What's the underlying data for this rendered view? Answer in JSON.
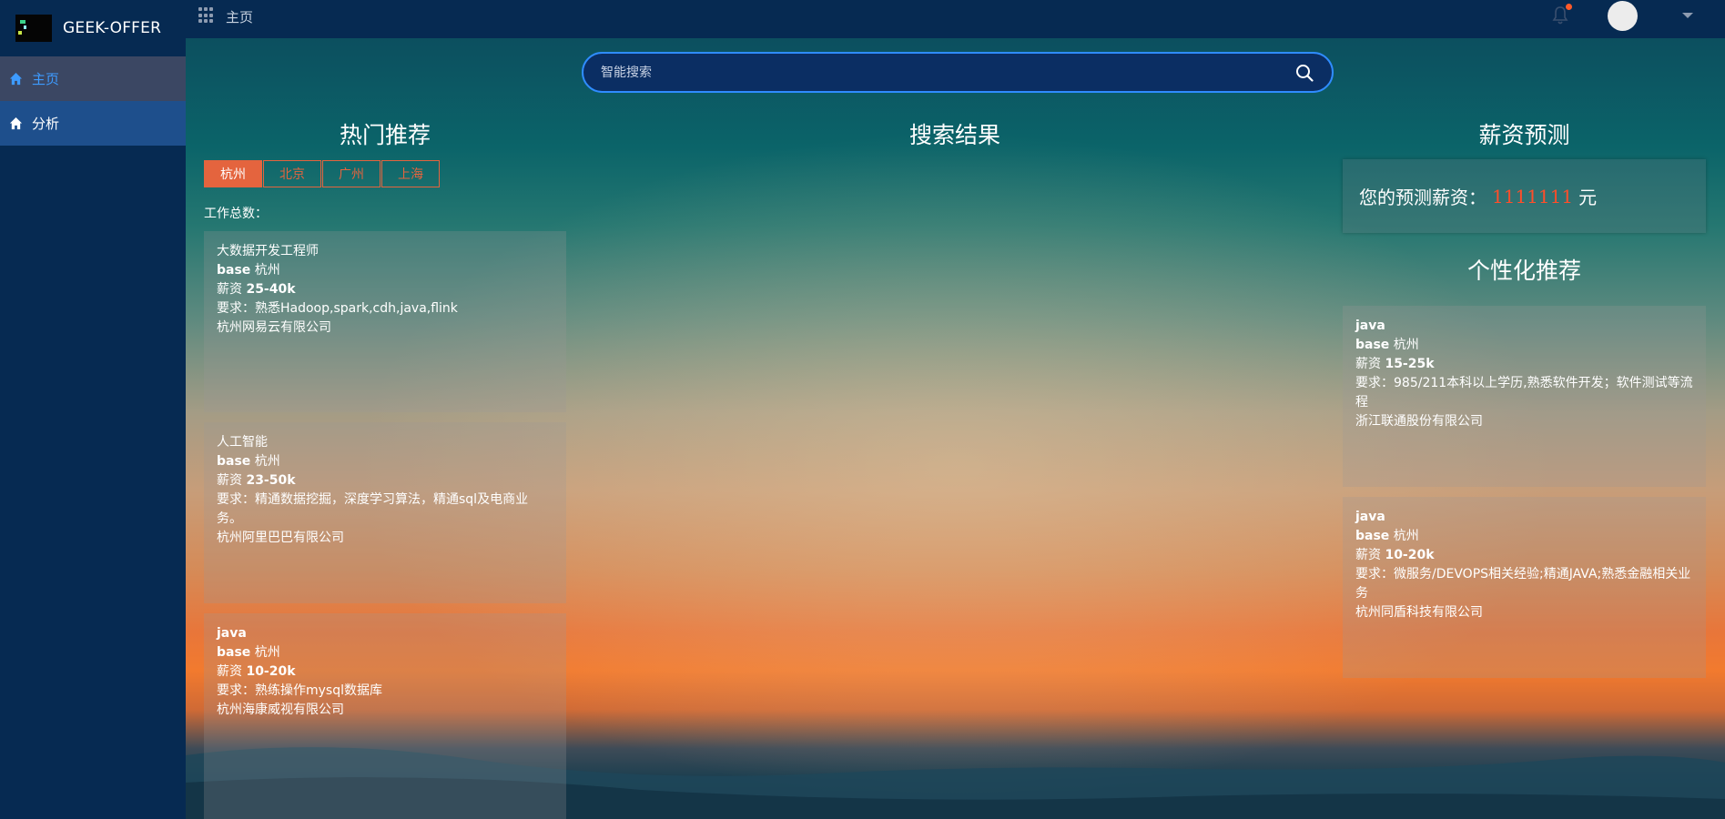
{
  "brand": {
    "title": "GEEK-OFFER"
  },
  "sidebar": {
    "items": [
      {
        "label": "主页"
      },
      {
        "label": "分析"
      }
    ]
  },
  "topbar": {
    "breadcrumb": "主页"
  },
  "search": {
    "placeholder": "智能搜索"
  },
  "hot": {
    "title": "热门推荐",
    "tabs": [
      "杭州",
      "北京",
      "广州",
      "上海"
    ],
    "count_label": "工作总数：",
    "jobs": [
      {
        "title": "大数据开发工程师",
        "base": "杭州",
        "salary": "25-40k",
        "req": "熟悉Hadoop,spark,cdh,java,flink",
        "company": "杭州网易云有限公司"
      },
      {
        "title": "人工智能",
        "base": "杭州",
        "salary": "23-50k",
        "req": "精通数据挖掘，深度学习算法，精通sql及电商业务。",
        "company": "杭州阿里巴巴有限公司"
      },
      {
        "title": "java",
        "base": "杭州",
        "salary": "10-20k",
        "req": "熟练操作mysql数据库",
        "company": "杭州海康威视有限公司"
      }
    ]
  },
  "results": {
    "title": "搜索结果"
  },
  "predict": {
    "title": "薪资预测",
    "prefix": "您的预测薪资：",
    "value": "1111111",
    "unit": "元"
  },
  "personal": {
    "title": "个性化推荐",
    "jobs": [
      {
        "title": "java",
        "base": "杭州",
        "salary": "15-25k",
        "req": "985/211本科以上学历,熟悉软件开发；软件测试等流程",
        "company": "浙江联通股份有限公司"
      },
      {
        "title": "java",
        "base": "杭州",
        "salary": "10-20k",
        "req": "微服务/DEVOPS相关经验;精通JAVA;熟悉金融相关业务",
        "company": "杭州同盾科技有限公司"
      }
    ]
  },
  "labels": {
    "base": "base",
    "salary": "薪资",
    "req": "要求："
  },
  "colors": {
    "accent": "#e4643e",
    "highlight": "#ff4e2a",
    "sidebar": "#062a52",
    "search_border": "#2f8cff"
  }
}
